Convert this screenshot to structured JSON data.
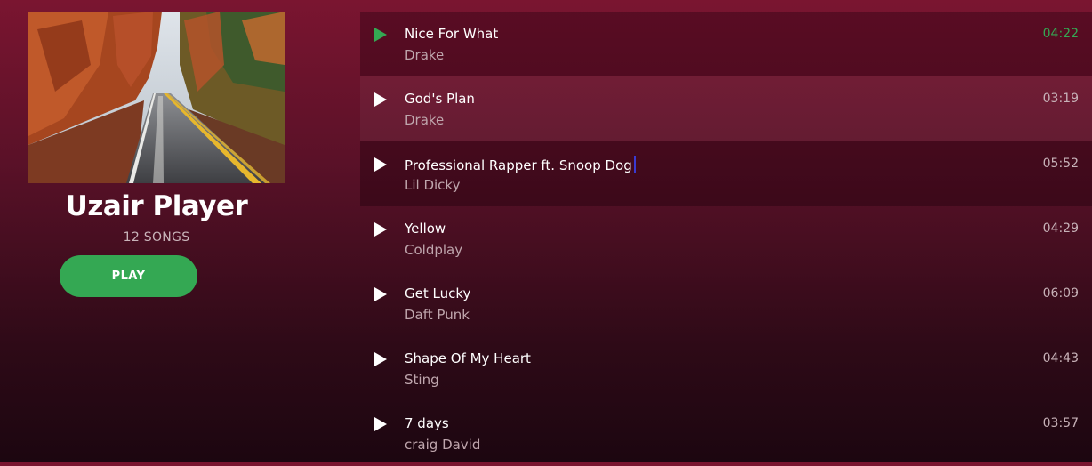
{
  "player": {
    "title": "Uzair Player",
    "song_count": "12 SONGS",
    "play_label": "PLAY"
  },
  "colors": {
    "accent": "#34a853",
    "background_top": "#7a1530",
    "background_bottom": "#1c0610"
  },
  "songs": [
    {
      "title": "Nice For What",
      "artist": "Drake",
      "duration": "04:22",
      "state": "playing",
      "icon": "play-icon"
    },
    {
      "title": "God's Plan",
      "artist": "Drake",
      "duration": "03:19",
      "state": "normal",
      "icon": "play-icon"
    },
    {
      "title": "Professional Rapper ft. Snoop Dog",
      "artist": "Lil Dicky",
      "duration": "05:52",
      "state": "hover",
      "icon": "play-icon"
    },
    {
      "title": "Yellow",
      "artist": "Coldplay",
      "duration": "04:29",
      "state": "normal",
      "icon": "play-icon"
    },
    {
      "title": "Get Lucky",
      "artist": "Daft Punk",
      "duration": "06:09",
      "state": "normal",
      "icon": "play-icon"
    },
    {
      "title": "Shape Of My Heart",
      "artist": "Sting",
      "duration": "04:43",
      "state": "normal",
      "icon": "play-icon"
    },
    {
      "title": "7 days",
      "artist": "craig David",
      "duration": "03:57",
      "state": "normal",
      "icon": "play-icon"
    }
  ]
}
